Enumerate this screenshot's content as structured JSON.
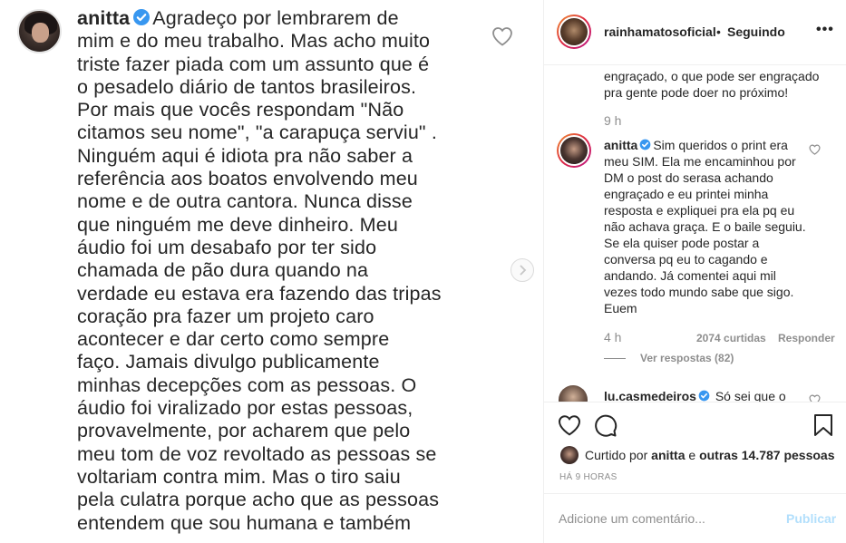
{
  "media": {
    "avatar_icon": "profile-photo",
    "username": "anitta",
    "text": "Agradeço por lembrarem de mim e do meu trabalho. Mas acho muito triste fazer piada com um assunto que é o pesadelo diário de tantos brasileiros. Por mais que vocês respondam \"Não citamos seu nome\", \"a carapuça serviu\" . Ninguém aqui é idiota pra não saber a referência aos boatos envolvendo meu nome e de outra cantora. Nunca disse que ninguém me deve dinheiro. Meu áudio foi um desabafo por ter sido chamada de pão dura quando na verdade eu estava era fazendo das tripas coração pra fazer um projeto caro acontecer e dar certo como sempre faço. Jamais divulgo publicamente minhas decepções com as pessoas. O áudio foi viralizado por estas pessoas, provavelmente, por acharem que pelo meu tom de voz revoltado as pessoas se voltariam contra mim. Mas o tiro saiu pela culatra porque acho que as pessoas entendem que sou humana e também",
    "lines": [
      "Agradeço por lembrarem de",
      "mim e do meu trabalho. Mas acho muito",
      "triste fazer piada com um assunto que é",
      "o pesadelo diário de tantos brasileiros.",
      "Por mais que vocês respondam \"Não",
      "citamos seu nome\", \"a carapuça serviu\" .",
      "Ninguém aqui é idiota pra não saber a",
      "referência aos boatos envolvendo meu",
      "nome e de outra cantora. Nunca disse",
      "que ninguém me deve dinheiro. Meu",
      "áudio foi um desabafo por ter sido",
      "chamada de pão dura quando na",
      "verdade eu estava era fazendo das tripas",
      "coração pra fazer um projeto caro",
      "acontecer e dar certo como sempre",
      "faço. Jamais divulgo publicamente",
      "minhas decepções com as pessoas. O",
      "áudio foi viralizado por estas pessoas,",
      "provavelmente, por acharem que pelo",
      "meu tom de voz revoltado as pessoas se",
      "voltariam contra mim. Mas o tiro saiu",
      "pela culatra porque acho que as pessoas",
      "entendem que sou humana e também"
    ]
  },
  "header": {
    "username": "rainhamatosoficial",
    "separator": "•",
    "follow_status": "Seguindo",
    "more": "•••"
  },
  "comments": {
    "previous": {
      "text": "engraçado, o que pode ser engraçado pra gente pode doer no próximo!",
      "time": "9 h"
    },
    "main": {
      "username": "anitta",
      "text": "Sim queridos o print era meu SIM. Ela me encaminhou por DM o post do serasa achando engraçado e eu printei minha resposta e expliquei pra ela pq eu não achava graça. E o baile seguiu. Se ela quiser pode postar a conversa pq eu to cagando e andando. Já comentei aqui mil vezes todo mundo sabe que sigo. Euem",
      "time": "4 h",
      "likes": "2074 curtidas",
      "reply": "Responder",
      "view_replies": "Ver respostas (82)"
    },
    "next": {
      "username": "lu.casmedeiros",
      "text": "Só sei que o"
    }
  },
  "actions": {
    "liked_by_prefix": "Curtido por",
    "liked_by_user": "anitta",
    "liked_by_and": "e",
    "liked_by_others": "outras 14.787 pessoas",
    "time": "HÁ 9 HORAS"
  },
  "add_comment": {
    "placeholder": "Adicione um comentário...",
    "publish": "Publicar"
  },
  "colors": {
    "text": "#262626",
    "muted": "#8e8e8e",
    "verified": "#3897f0",
    "publish_disabled": "#b2dffc",
    "border": "#efefef"
  }
}
